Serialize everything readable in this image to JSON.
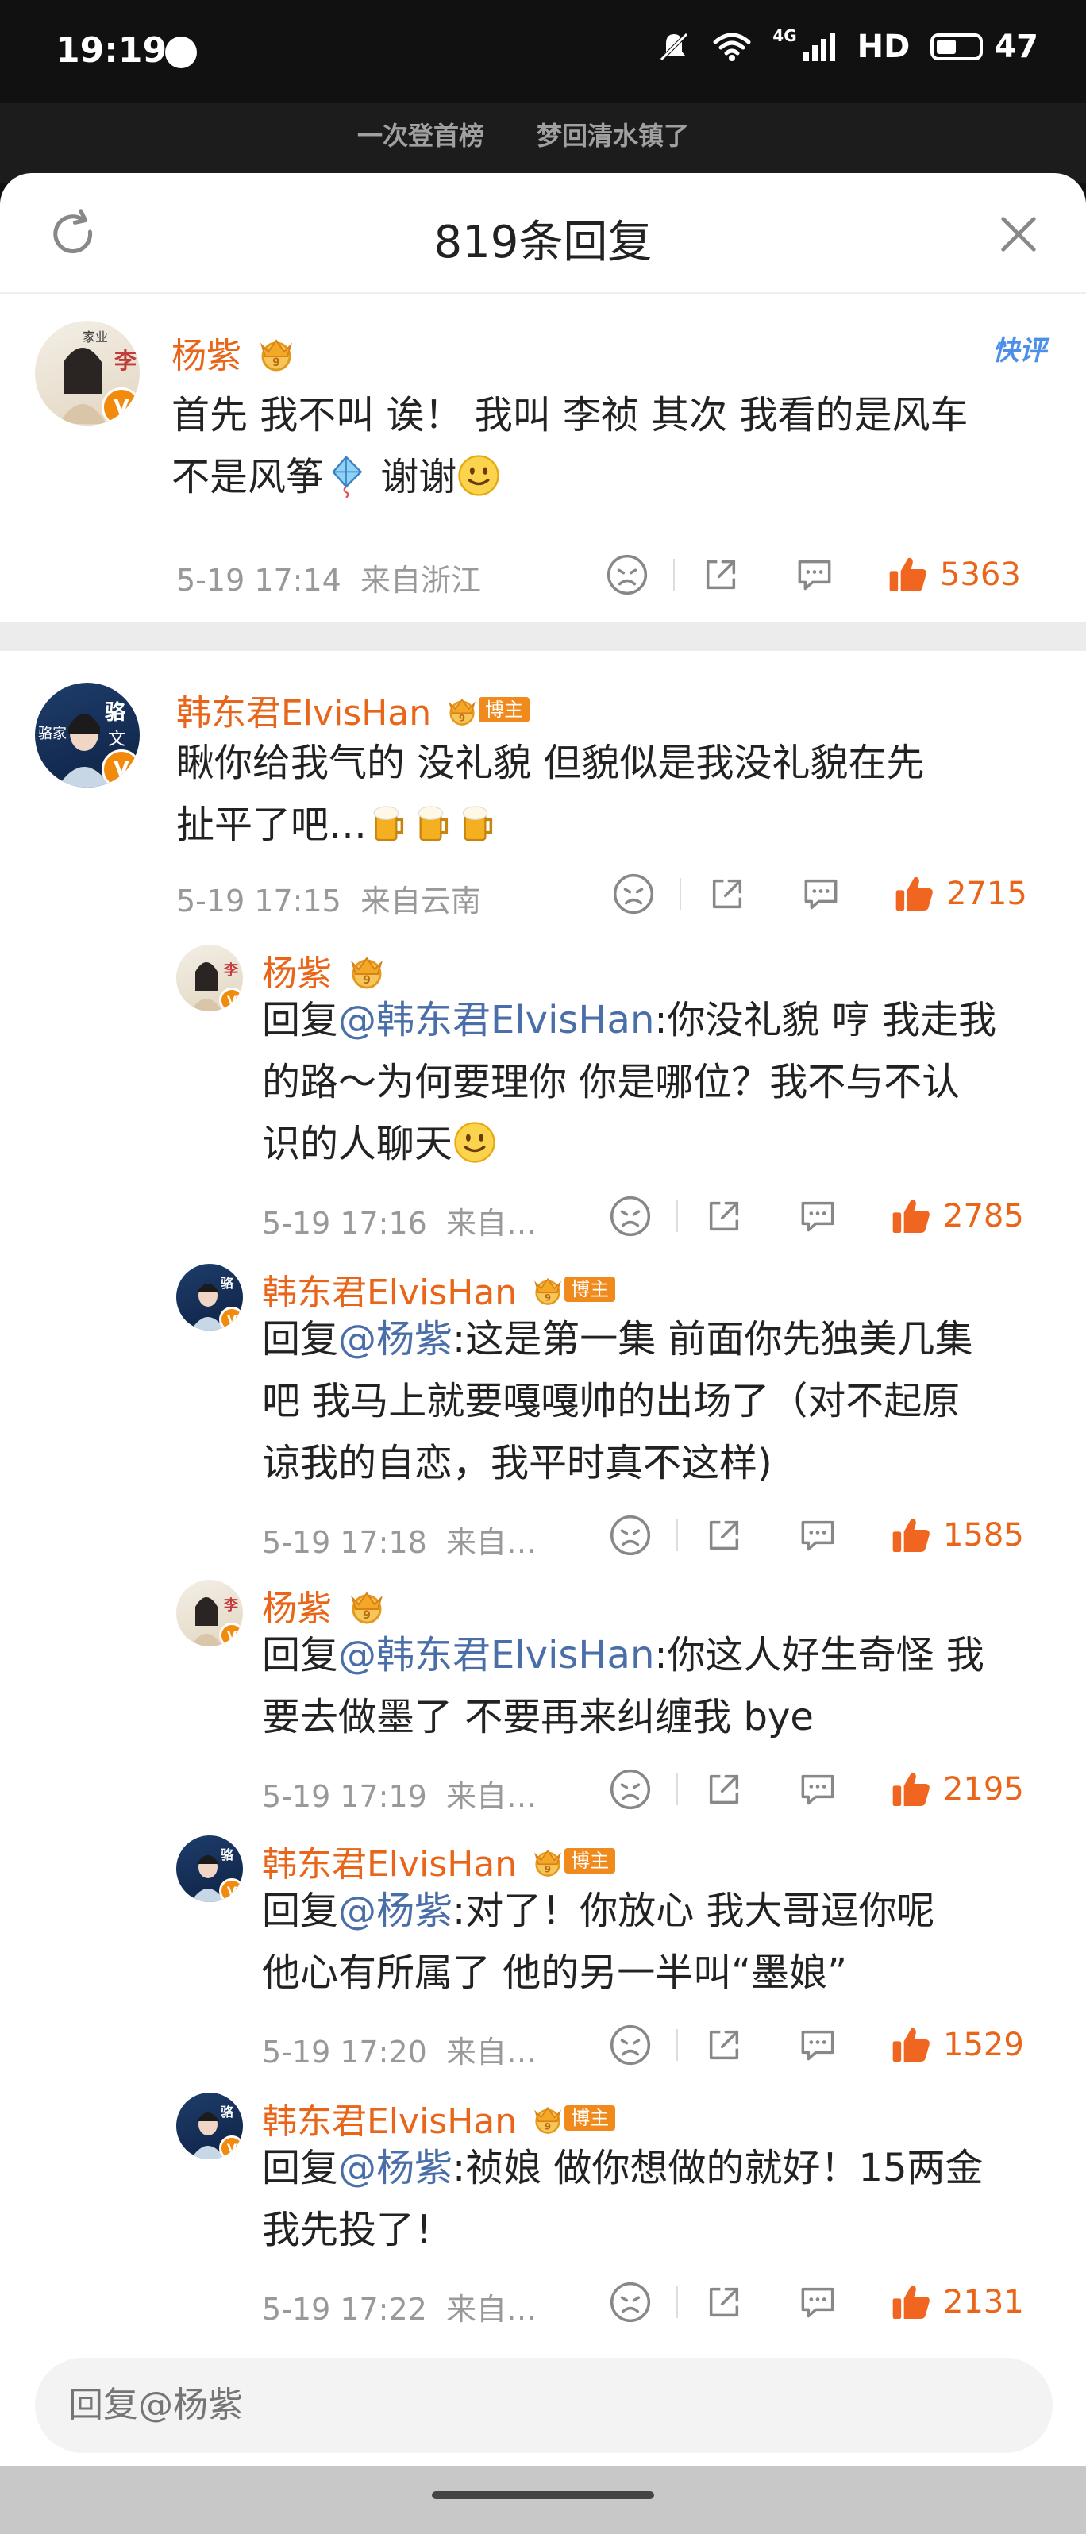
{
  "status_bar": {
    "time": "19:19",
    "network": "4G",
    "hd": "HD",
    "battery": "47",
    "battery_level": 0.47
  },
  "behind": {
    "text_1": "一次登首榜",
    "text_2": "梦回清水镇了"
  },
  "sheet": {
    "title": "819条回复",
    "kuaiping": "快评"
  },
  "comments": [
    {
      "name": "杨紫",
      "text_1": "首先 我不叫 诶！ 我叫 李祯 其次 我看的是风车",
      "text_2": "不是风筝",
      "text_3": " 谢谢",
      "time": "5-19 17:14",
      "location": "来自浙江",
      "likes": "5363"
    },
    {
      "name": "韩东君ElvisHan",
      "badge": "博主",
      "text_1": "瞅你给我气的 没礼貌 但貌似是我没礼貌在先",
      "text_2": "扯平了吧…",
      "time": "5-19 17:15",
      "location": "来自云南",
      "likes": "2715"
    }
  ],
  "replies": [
    {
      "name": "杨紫",
      "prefix": "回复",
      "mention": "@韩东君ElvisHan",
      "text_1": ":你没礼貌 哼 我走我",
      "text_2": "的路～为何要理你 你是哪位？我不与不认",
      "text_3": "识的人聊天",
      "time": "5-19 17:16",
      "location": "来自…",
      "likes": "2785"
    },
    {
      "name": "韩东君ElvisHan",
      "badge": "博主",
      "prefix": "回复",
      "mention": "@杨紫",
      "text_1": ":这是第一集  前面你先独美几集",
      "text_2": "吧  我马上就要嘎嘎帅的出场了（对不起原",
      "text_3": "谅我的自恋，我平时真不这样)",
      "time": "5-19 17:18",
      "location": "来自…",
      "likes": "1585"
    },
    {
      "name": "杨紫",
      "prefix": "回复",
      "mention": "@韩东君ElvisHan",
      "text_1": ":你这人好生奇怪 我",
      "text_2": "要去做墨了 不要再来纠缠我 bye",
      "time": "5-19 17:19",
      "location": "来自…",
      "likes": "2195"
    },
    {
      "name": "韩东君ElvisHan",
      "badge": "博主",
      "prefix": "回复",
      "mention": "@杨紫",
      "text_1": ":对了！你放心 我大哥逗你呢",
      "text_2": "他心有所属了  他的另一半叫“墨娘”",
      "time": "5-19 17:20",
      "location": "来自…",
      "likes": "1529"
    },
    {
      "name": "韩东君ElvisHan",
      "badge": "博主",
      "prefix": "回复",
      "mention": "@杨紫",
      "text_1": ":祯娘  做你想做的就好！15两金",
      "text_2": "我先投了！",
      "time": "5-19 17:22",
      "location": "来自…",
      "likes": "2131"
    }
  ],
  "reply_input": {
    "placeholder": "回复@杨紫"
  },
  "icons": {
    "refresh": "refresh-icon",
    "close": "close-icon",
    "dislike": "dislike-face-icon",
    "share": "share-icon",
    "comment": "comment-icon",
    "like": "thumbs-up-icon",
    "crown": "crown-icon",
    "verified": "verified-v-icon",
    "kite": "kite-icon",
    "smile": "smile-emoji",
    "beer": "beer-emoji"
  },
  "colors": {
    "name": "#e8651a",
    "mention": "#4a6ea8",
    "like": "#e8651a",
    "badge": "#f08a1c",
    "kuaiping": "#4b8fe8"
  }
}
